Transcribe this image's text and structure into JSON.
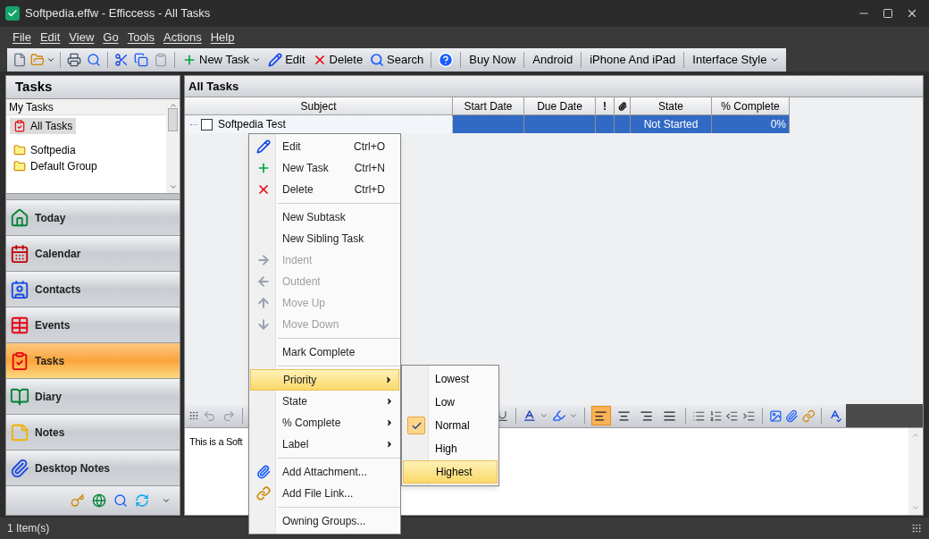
{
  "window": {
    "title": "Softpedia.effw - Efficcess - All Tasks"
  },
  "menu_bar": [
    "File",
    "Edit",
    "View",
    "Go",
    "Tools",
    "Actions",
    "Help"
  ],
  "toolbar": {
    "buttons": [
      {
        "label": "New Task",
        "dropdown": true
      },
      {
        "label": "Edit",
        "dropdown": false
      },
      {
        "label": "Delete",
        "dropdown": false
      },
      {
        "label": "Search",
        "dropdown": false
      }
    ],
    "links": [
      {
        "label": "Buy Now",
        "dropdown": false
      },
      {
        "label": "Android",
        "dropdown": false
      },
      {
        "label": "iPhone And iPad",
        "dropdown": false
      },
      {
        "label": "Interface Style",
        "dropdown": true
      }
    ]
  },
  "sidebar": {
    "title": "Tasks",
    "tree_header": "My Tasks",
    "tree": [
      {
        "label": "All Tasks",
        "selected": true
      },
      {
        "label": "Softpedia",
        "selected": false
      },
      {
        "label": "Default Group",
        "selected": false
      }
    ],
    "nav": [
      {
        "label": "Today",
        "selected": false
      },
      {
        "label": "Calendar",
        "selected": false
      },
      {
        "label": "Contacts",
        "selected": false
      },
      {
        "label": "Events",
        "selected": false
      },
      {
        "label": "Tasks",
        "selected": true
      },
      {
        "label": "Diary",
        "selected": false
      },
      {
        "label": "Notes",
        "selected": false
      },
      {
        "label": "Desktop Notes",
        "selected": false
      }
    ]
  },
  "main": {
    "title": "All Tasks",
    "table": {
      "columns": [
        {
          "kind": "text",
          "label": "Subject"
        },
        {
          "kind": "text",
          "label": "Start Date"
        },
        {
          "kind": "text",
          "label": "Due Date"
        },
        {
          "kind": "text",
          "label": "!"
        },
        {
          "kind": "icon"
        },
        {
          "kind": "text",
          "label": "State"
        },
        {
          "kind": "text",
          "label": "% Complete"
        }
      ],
      "rows": [
        {
          "selected": true,
          "checked": false,
          "cells": [
            "Softpedia Test",
            "",
            "",
            "",
            "",
            "Not Started",
            "0%"
          ]
        }
      ]
    },
    "editor": {
      "alignment": [
        {
          "selected": true
        },
        {
          "selected": false
        },
        {
          "selected": false
        },
        {
          "selected": false
        }
      ],
      "text": "This is a Soft"
    }
  },
  "context_menu": [
    {
      "kind": "item",
      "label": "Edit",
      "shortcut": "Ctrl+O",
      "disabled": false,
      "submenu": false,
      "selected": false
    },
    {
      "kind": "item",
      "label": "New Task",
      "shortcut": "Ctrl+N",
      "disabled": false,
      "submenu": false,
      "selected": false
    },
    {
      "kind": "item",
      "label": "Delete",
      "shortcut": "Ctrl+D",
      "disabled": false,
      "submenu": false,
      "selected": false
    },
    {
      "kind": "separator"
    },
    {
      "kind": "item",
      "label": "New Subtask",
      "disabled": false,
      "submenu": false,
      "selected": false
    },
    {
      "kind": "item",
      "label": "New Sibling Task",
      "disabled": false,
      "submenu": false,
      "selected": false
    },
    {
      "kind": "item",
      "label": "Indent",
      "disabled": true,
      "submenu": false,
      "selected": false
    },
    {
      "kind": "item",
      "label": "Outdent",
      "disabled": true,
      "submenu": false,
      "selected": false
    },
    {
      "kind": "item",
      "label": "Move Up",
      "disabled": true,
      "submenu": false,
      "selected": false
    },
    {
      "kind": "item",
      "label": "Move Down",
      "disabled": true,
      "submenu": false,
      "selected": false
    },
    {
      "kind": "separator"
    },
    {
      "kind": "item",
      "label": "Mark Complete",
      "disabled": false,
      "submenu": false,
      "selected": false
    },
    {
      "kind": "separator"
    },
    {
      "kind": "item",
      "label": "Priority",
      "disabled": false,
      "submenu": true,
      "selected": true
    },
    {
      "kind": "item",
      "label": "State",
      "disabled": false,
      "submenu": true,
      "selected": false
    },
    {
      "kind": "item",
      "label": "% Complete",
      "disabled": false,
      "submenu": true,
      "selected": false
    },
    {
      "kind": "item",
      "label": "Label",
      "disabled": false,
      "submenu": true,
      "selected": false
    },
    {
      "kind": "separator"
    },
    {
      "kind": "item",
      "label": "Add Attachment...",
      "disabled": false,
      "submenu": false,
      "selected": false
    },
    {
      "kind": "item",
      "label": "Add File Link...",
      "disabled": false,
      "submenu": false,
      "selected": false
    },
    {
      "kind": "separator"
    },
    {
      "kind": "item",
      "label": "Owning Groups...",
      "disabled": false,
      "submenu": false,
      "selected": false
    }
  ],
  "priority_submenu": [
    {
      "label": "Lowest",
      "checked": false,
      "selected": false
    },
    {
      "label": "Low",
      "checked": false,
      "selected": false
    },
    {
      "label": "Normal",
      "checked": true,
      "selected": false
    },
    {
      "label": "High",
      "checked": false,
      "selected": false
    },
    {
      "label": "Highest",
      "checked": false,
      "selected": true
    }
  ],
  "status_bar": {
    "text": "1 Item(s)"
  }
}
